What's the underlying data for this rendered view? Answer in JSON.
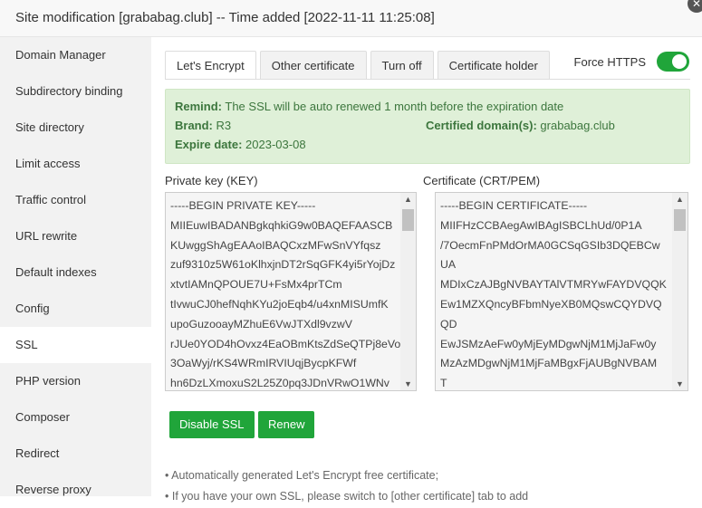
{
  "window": {
    "title": "Site modification [grababag.club] -- Time added [2022-11-11 11:25:08]",
    "close_glyph": "✕"
  },
  "sidebar": {
    "items": [
      {
        "label": "Domain Manager"
      },
      {
        "label": "Subdirectory binding"
      },
      {
        "label": "Site directory"
      },
      {
        "label": "Limit access"
      },
      {
        "label": "Traffic control"
      },
      {
        "label": "URL rewrite"
      },
      {
        "label": "Default indexes"
      },
      {
        "label": "Config"
      },
      {
        "label": "SSL"
      },
      {
        "label": "PHP version"
      },
      {
        "label": "Composer"
      },
      {
        "label": "Redirect"
      },
      {
        "label": "Reverse proxy"
      }
    ],
    "active": "SSL"
  },
  "tabs": [
    {
      "label": "Let's Encrypt"
    },
    {
      "label": "Other certificate"
    },
    {
      "label": "Turn off"
    },
    {
      "label": "Certificate holder"
    }
  ],
  "force_https": {
    "label": "Force HTTPS",
    "enabled": true
  },
  "remind": {
    "remind_label": "Remind:",
    "remind_text": "The SSL will be auto renewed 1 month before the expiration date",
    "brand_label": "Brand:",
    "brand_value": "R3",
    "domain_label": "Certified domain(s):",
    "domain_value": "grababag.club",
    "expire_label": "Expire date:",
    "expire_value": "2023-03-08"
  },
  "private_key": {
    "label": "Private key (KEY)",
    "value": "-----BEGIN PRIVATE KEY-----\nMIIEuwIBADANBgkqhkiG9w0BAQEFAASCB\nKUwggShAgEAAoIBAQCxzMFwSnVYfqsz\nzuf9310z5W61oKlhxjnDT2rSqGFK4yi5rYojDz\nxtvtIAMnQPOUE7U+FsMx4prTCm\ntIvwuCJ0hefNqhKYu2joEqb4/u4xnMISUmfK\nupoGuzooayMZhuE6VwJTXdl9vzwV\nrJUe0YOD4hOvxz4EaOBmKtsZdSeQTPj8eVo\n3OaWyj/rKS4WRmIRVIUqjBycpKFWf\nhn6DzLXmoxuS2L25Z0pq3JDnVRwO1WNv"
  },
  "certificate": {
    "label": "Certificate (CRT/PEM)",
    "value": "-----BEGIN CERTIFICATE-----\nMIIFHzCCBAegAwIBAgISBCLhUd/0P1A\n/7OecmFnPMdOrMA0GCSqGSIb3DQEBCw\nUA\nMDIxCzAJBgNVBAYTAlVTMRYwFAYDVQQK\nEw1MZXQncyBFbmNyeXB0MQswCQYDVQ\nQD\nEwJSMzAeFw0yMjEyMDgwNjM1MjJaFw0y\nMzAzMDgwNjM1MjFaMBgxFjAUBgNVBAM\nT"
  },
  "buttons": {
    "disable": "Disable SSL",
    "renew": "Renew"
  },
  "notes": [
    "Automatically generated Let's Encrypt free certificate;",
    "If you have your own SSL, please switch to [other certificate] tab to add"
  ],
  "colors": {
    "accent": "#20a53a",
    "remind_bg": "#dff0d8",
    "remind_text": "#3c763d"
  }
}
